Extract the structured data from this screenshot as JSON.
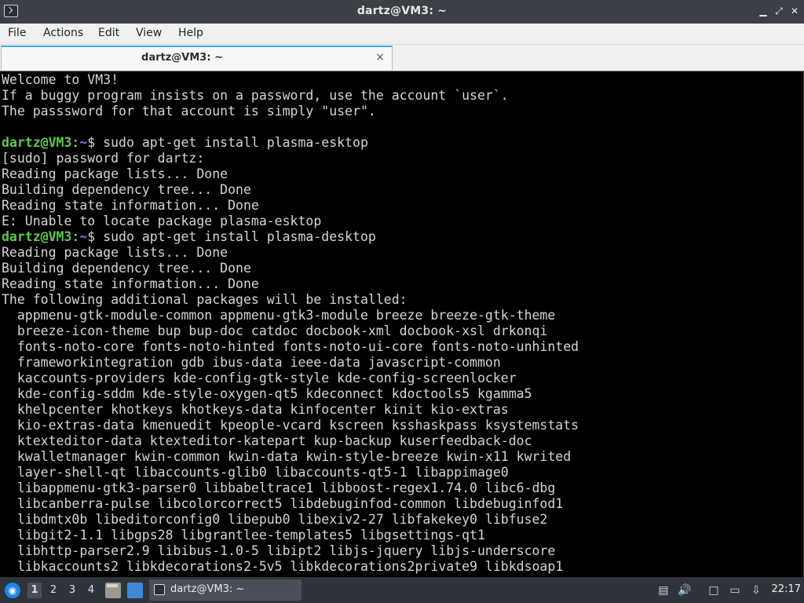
{
  "window": {
    "title": "dartz@VM3: ~",
    "controls": [
      "minimize",
      "maximize",
      "close"
    ]
  },
  "menu": [
    "File",
    "Actions",
    "Edit",
    "View",
    "Help"
  ],
  "tab": {
    "label": "dartz@VM3: ~",
    "close": "×"
  },
  "terminal": {
    "lines": [
      {
        "text": "Welcome to VM3!"
      },
      {
        "text": "If a buggy program insists on a password, use the account `user`."
      },
      {
        "text": "The passsword for that account is simply \"user\"."
      },
      {
        "text": ""
      },
      {
        "user": "dartz@VM3",
        "path": "~",
        "cmd": "$ sudo apt-get install plasma-esktop"
      },
      {
        "text": "[sudo] password for dartz:"
      },
      {
        "text": "Reading package lists... Done"
      },
      {
        "text": "Building dependency tree... Done"
      },
      {
        "text": "Reading state information... Done"
      },
      {
        "text": "E: Unable to locate package plasma-esktop"
      },
      {
        "user": "dartz@VM3",
        "path": "~",
        "cmd": "$ sudo apt-get install plasma-desktop"
      },
      {
        "text": "Reading package lists... Done"
      },
      {
        "text": "Building dependency tree... Done"
      },
      {
        "text": "Reading state information... Done"
      },
      {
        "text": "The following additional packages will be installed:"
      },
      {
        "text": "  appmenu-gtk-module-common appmenu-gtk3-module breeze breeze-gtk-theme"
      },
      {
        "text": "  breeze-icon-theme bup bup-doc catdoc docbook-xml docbook-xsl drkonqi"
      },
      {
        "text": "  fonts-noto-core fonts-noto-hinted fonts-noto-ui-core fonts-noto-unhinted"
      },
      {
        "text": "  frameworkintegration gdb ibus-data ieee-data javascript-common"
      },
      {
        "text": "  kaccounts-providers kde-config-gtk-style kde-config-screenlocker"
      },
      {
        "text": "  kde-config-sddm kde-style-oxygen-qt5 kdeconnect kdoctools5 kgamma5"
      },
      {
        "text": "  khelpcenter khotkeys khotkeys-data kinfocenter kinit kio-extras"
      },
      {
        "text": "  kio-extras-data kmenuedit kpeople-vcard kscreen ksshaskpass ksystemstats"
      },
      {
        "text": "  ktexteditor-data ktexteditor-katepart kup-backup kuserfeedback-doc"
      },
      {
        "text": "  kwalletmanager kwin-common kwin-data kwin-style-breeze kwin-x11 kwrited"
      },
      {
        "text": "  layer-shell-qt libaccounts-glib0 libaccounts-qt5-1 libappimage0"
      },
      {
        "text": "  libappmenu-gtk3-parser0 libbabeltrace1 libboost-regex1.74.0 libc6-dbg"
      },
      {
        "text": "  libcanberra-pulse libcolorcorrect5 libdebuginfod-common libdebuginfod1"
      },
      {
        "text": "  libdmtx0b libeditorconfig0 libepub0 libexiv2-27 libfakekey0 libfuse2"
      },
      {
        "text": "  libgit2-1.1 libgps28 libgrantlee-templates5 libgsettings-qt1"
      },
      {
        "text": "  libhttp-parser2.9 libibus-1.0-5 libipt2 libjs-jquery libjs-underscore"
      },
      {
        "text": "  libkaccounts2 libkdecorations2-5v5 libkdecorations2private9 libkdsoap1"
      }
    ]
  },
  "taskbar": {
    "workspaces": [
      "1",
      "2",
      "3",
      "4"
    ],
    "active_workspace": "1",
    "task_label": "dartz@VM3: ~",
    "clock": "22:17"
  }
}
